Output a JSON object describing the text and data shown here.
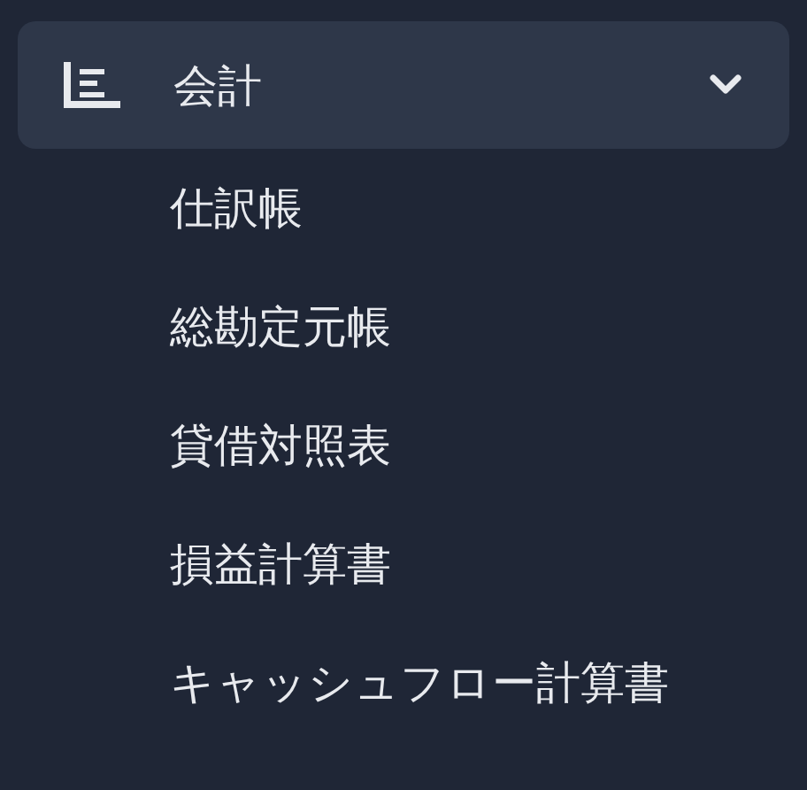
{
  "menu": {
    "label": "会計",
    "expanded": true,
    "children": [
      {
        "label": "仕訳帳"
      },
      {
        "label": "総勘定元帳"
      },
      {
        "label": "貸借対照表"
      },
      {
        "label": "損益計算書"
      },
      {
        "label": "キャッシュフロー計算書"
      }
    ]
  }
}
